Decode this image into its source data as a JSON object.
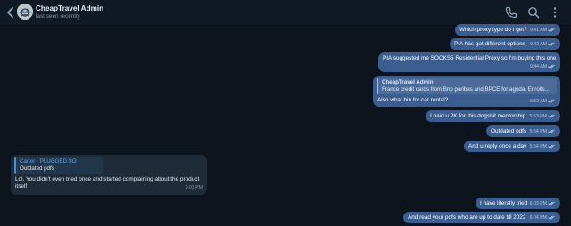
{
  "header": {
    "title": "CheapTravel Admin",
    "status": "last seen recently",
    "icons": [
      "back-arrow-icon",
      "phone-icon",
      "search-icon",
      "more-vertical-icon"
    ]
  },
  "messages": [
    {
      "dir": "out",
      "text": "Which proxy type do I get?",
      "time": "9:41 AM"
    },
    {
      "dir": "out",
      "text": "PIA has got different options",
      "time": "9:42 AM"
    },
    {
      "dir": "out",
      "text": "PIA suggested me SOCKS5 Residential Proxy so I'm buying this one",
      "time": "9:44 AM"
    },
    {
      "dir": "out",
      "reply_name": "CheapTravel Admin",
      "reply_text": "France credit cards from Bnp paribas and BPCE for agoda. Enrolls...",
      "text": "Also what bin for car rental?",
      "time": "8:52 AM"
    },
    {
      "dir": "out",
      "text": "I paid u 2K for this dogshit mentorship",
      "time": "5:53 PM"
    },
    {
      "dir": "out",
      "text": "Outdated pdfs",
      "time": "5:54 PM"
    },
    {
      "dir": "out",
      "text": "And u reply once a day",
      "time": "5:54 PM"
    },
    {
      "dir": "in",
      "reply_name": "Carter - PLUGGED.SO",
      "reply_text": "Outdated pdfs",
      "text": "Lol. You didn't even tried once and started complaining about the product",
      "text2": "itself",
      "time": "6:03 PM"
    },
    {
      "dir": "out",
      "text": "I have literally tried",
      "time": "6:03 PM"
    },
    {
      "dir": "out",
      "text": "And read your pdfs who are up to date till 2022",
      "time": "6:04 PM"
    }
  ],
  "colors": {
    "background": "#0d141d",
    "header": "#111a24",
    "outgoing_bubble": "#3b5d8f",
    "incoming_bubble": "#1e2c3a",
    "accent": "#5aa2ec"
  }
}
